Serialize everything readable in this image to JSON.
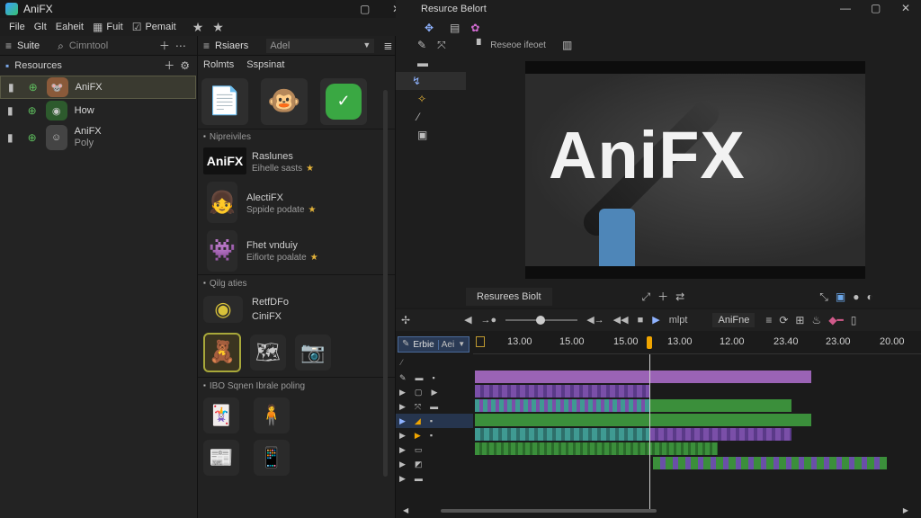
{
  "app": {
    "title": "AniFX",
    "window_controls": [
      "restore-icon",
      "close-icon"
    ]
  },
  "menu": {
    "items": [
      {
        "label": "File",
        "icon": ""
      },
      {
        "label": "Glt",
        "icon": ""
      },
      {
        "label": "Eaheit",
        "icon": ""
      },
      {
        "label": "Fuit",
        "icon": "grid-icon"
      },
      {
        "label": "Pemait",
        "icon": "check-icon"
      }
    ]
  },
  "left_panel": {
    "tab_label": "Suite",
    "search_placeholder": "Cimntool",
    "resources_label": "Resources",
    "items": [
      {
        "label": "AniFX",
        "sub": "",
        "selected": true
      },
      {
        "label": "How",
        "sub": "",
        "selected": false
      },
      {
        "label": "AniFX",
        "sub": "Poly",
        "selected": false
      }
    ]
  },
  "library_panel": {
    "tab_label": "Rsiaers",
    "dropdown_value": "Adel",
    "sub_tabs": [
      "Rolmts",
      "Sspsinat"
    ],
    "sections": [
      {
        "title": "Nipreiviles",
        "items": [
          {
            "line1": "Raslunes",
            "line2": "Eihelle sasts"
          },
          {
            "line1": "AlectiFX",
            "line2": "Sppide podate"
          },
          {
            "line1": "Fhet vnduiy",
            "line2": "Eifiorte poalate"
          }
        ]
      },
      {
        "title": "Qilg aties",
        "items": [
          {
            "line1": "RetfDFo",
            "line2": "CiniFX"
          }
        ]
      },
      {
        "title": "IBO Sqnen Ibrale poling"
      }
    ],
    "logo_text": "AniFX"
  },
  "viewer": {
    "title": "Resurce Belort",
    "toolbar_label": "Reseoe ifeoet",
    "preview_text": "AniFX",
    "bottom_tab": "Resurees Biolt"
  },
  "timeline": {
    "controls_label": "mlpt",
    "profile_label": "AniFne",
    "track_dropdown": "Erbie",
    "track_dropdown_tag": "Aei",
    "ruler": [
      "13.00",
      "15.00",
      "15.00",
      "13.00",
      "12.00",
      "23.40",
      "23.00",
      "20.00"
    ],
    "playhead_percent": 0.39,
    "colors": {
      "purple": "#9a63b5",
      "green": "#3b8f3b",
      "teal": "#3f9a92",
      "accent": "#f0a500"
    }
  }
}
